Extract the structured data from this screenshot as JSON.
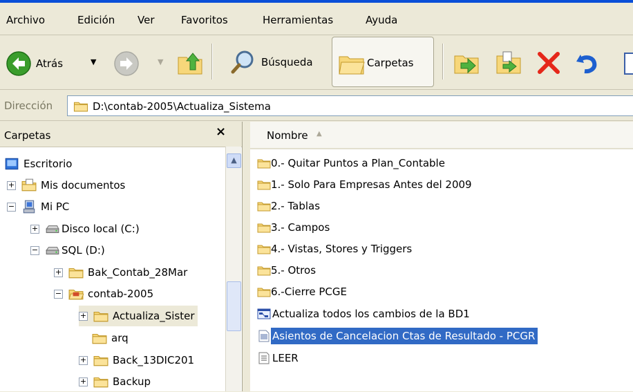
{
  "menubar": {
    "items": [
      "Archivo",
      "Edición",
      "Ver",
      "Favoritos",
      "Herramientas",
      "Ayuda"
    ]
  },
  "toolbar": {
    "back_label": "Atrás",
    "search_label": "Búsqueda",
    "folders_label": "Carpetas"
  },
  "address": {
    "label": "Dirección",
    "value": "D:\\contab-2005\\Actualiza_Sistema"
  },
  "left_pane": {
    "title": "Carpetas",
    "close": "×",
    "tree": [
      {
        "label": "Escritorio",
        "icon": "desktop-icon",
        "expander": ""
      },
      {
        "label": "Mis documentos",
        "icon": "my-documents-icon",
        "expander": "+"
      },
      {
        "label": "Mi PC",
        "icon": "my-computer-icon",
        "expander": "−"
      },
      {
        "label": "Disco local (C:)",
        "icon": "drive-icon",
        "expander": "+"
      },
      {
        "label": "SQL (D:)",
        "icon": "drive-icon",
        "expander": "−"
      },
      {
        "label": "Bak_Contab_28Mar",
        "icon": "folder-icon",
        "expander": "+"
      },
      {
        "label": "contab-2005",
        "icon": "open-folder-icon",
        "expander": "−"
      },
      {
        "label": "Actualiza_Sister",
        "icon": "folder-icon",
        "expander": "+"
      },
      {
        "label": "arq",
        "icon": "folder-icon",
        "expander": ""
      },
      {
        "label": "Back_13DIC201",
        "icon": "folder-icon",
        "expander": "+"
      },
      {
        "label": "Backup",
        "icon": "folder-icon",
        "expander": "+"
      }
    ]
  },
  "right_pane": {
    "column_name": "Nombre",
    "sort_indicator": "▲",
    "files": [
      {
        "name": "0.- Quitar Puntos a Plan_Contable",
        "icon": "folder-icon"
      },
      {
        "name": "1.- Solo Para Empresas Antes del 2009",
        "icon": "folder-icon"
      },
      {
        "name": "2.- Tablas",
        "icon": "folder-icon"
      },
      {
        "name": "3.- Campos",
        "icon": "folder-icon"
      },
      {
        "name": "4.- Vistas, Stores y Triggers",
        "icon": "folder-icon"
      },
      {
        "name": "5.- Otros",
        "icon": "folder-icon"
      },
      {
        "name": "6.-Cierre PCGE",
        "icon": "folder-icon"
      },
      {
        "name": "Actualiza todos los cambios de la BD1",
        "icon": "dts-package-icon"
      },
      {
        "name": "Asientos de Cancelacion Ctas de Resultado - PCGR",
        "icon": "sql-file-icon"
      },
      {
        "name": "LEER",
        "icon": "text-file-icon"
      }
    ]
  },
  "colors": {
    "selection": "#316ac5",
    "folder": "#f4d06a",
    "delete": "#e5271a",
    "back_arrow": "#3a9d2c"
  }
}
